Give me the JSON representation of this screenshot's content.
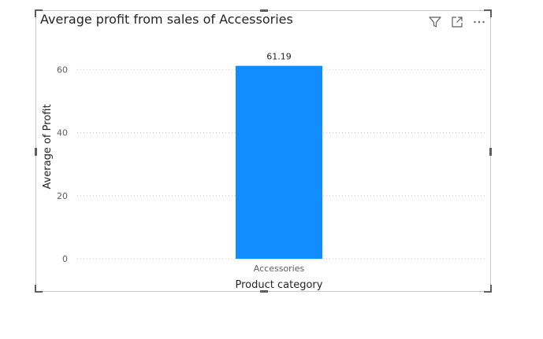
{
  "chart_data": {
    "type": "bar",
    "title": "Average profit from sales of Accessories",
    "xlabel": "Product category",
    "ylabel": "Average of Profit",
    "categories": [
      "Accessories"
    ],
    "values": [
      61.19
    ],
    "data_labels": [
      "61.19"
    ],
    "yticks": [
      "0",
      "20",
      "40",
      "60"
    ],
    "ytick_values": [
      0,
      20,
      40,
      60
    ],
    "ylim": [
      0,
      62
    ],
    "grid": true,
    "bar_color": "#118dff"
  },
  "header_icons": [
    "filter-icon",
    "focus-mode-icon",
    "more-options-icon"
  ]
}
